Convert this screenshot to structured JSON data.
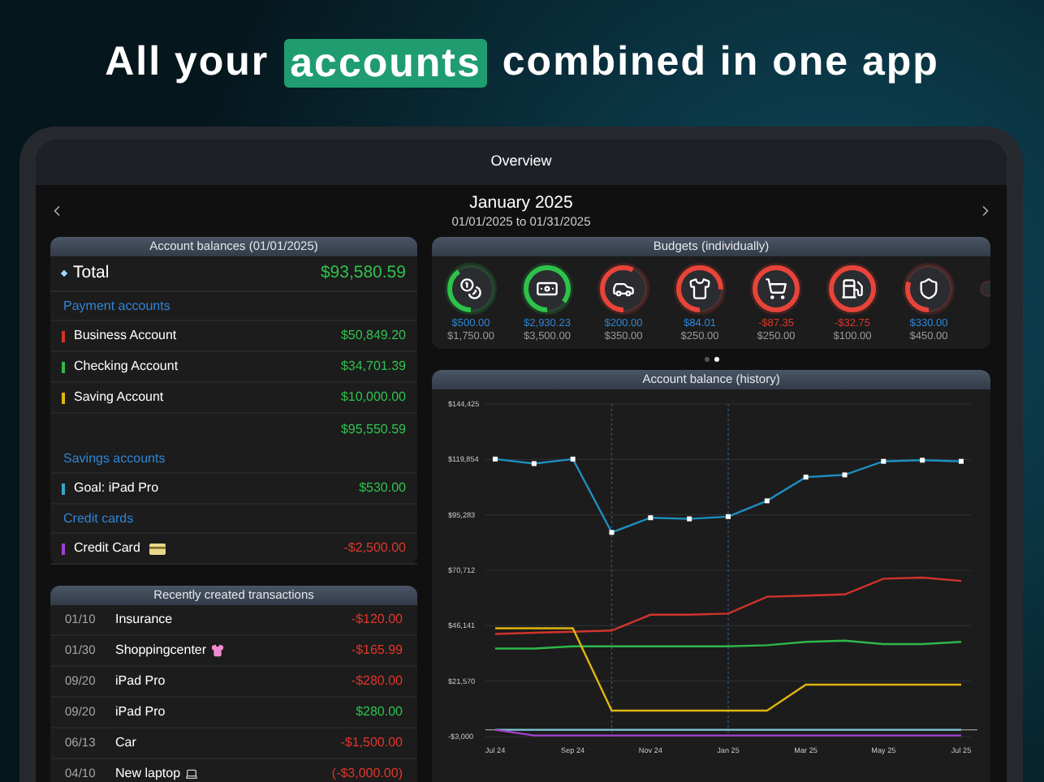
{
  "headline": {
    "before": "All your",
    "highlight": "accounts",
    "after": "combined in one app"
  },
  "window": {
    "title": "Overview"
  },
  "period": {
    "month": "January 2025",
    "range": "01/01/2025 to 01/31/2025"
  },
  "balances": {
    "title": "Account balances (01/01/2025)",
    "total": {
      "label": "Total",
      "amount": "$93,580.59"
    },
    "groups": [
      {
        "title": "Payment accounts",
        "accounts": [
          {
            "name": "Business Account",
            "amount": "$50,849.20",
            "color": "#d0342c",
            "negative": false
          },
          {
            "name": "Checking Account",
            "amount": "$34,701.39",
            "color": "#2eb84b",
            "negative": false
          },
          {
            "name": "Saving Account",
            "amount": "$10,000.00",
            "color": "#e0b50f",
            "negative": false
          }
        ],
        "subtotal": "$95,550.59"
      },
      {
        "title": "Savings accounts",
        "accounts": [
          {
            "name": "Goal: iPad Pro",
            "amount": "$530.00",
            "color": "#38a6c8",
            "negative": false
          }
        ]
      },
      {
        "title": "Credit cards",
        "accounts": [
          {
            "name": "Credit Card",
            "amount": "-$2,500.00",
            "color": "#a340d0",
            "negative": true
          }
        ]
      }
    ]
  },
  "transactions": {
    "title": "Recently created transactions",
    "rows": [
      {
        "date": "01/10",
        "name": "Insurance",
        "amount": "-$120.00",
        "kind": "expense"
      },
      {
        "date": "01/30",
        "name": "Shoppingcenter",
        "amount": "-$165.99",
        "kind": "expense"
      },
      {
        "date": "09/20",
        "name": "iPad Pro",
        "amount": "-$280.00",
        "kind": "expense"
      },
      {
        "date": "09/20",
        "name": "iPad Pro",
        "amount": "$280.00",
        "kind": "income"
      },
      {
        "date": "06/13",
        "name": "Car",
        "amount": "-$1,500.00",
        "kind": "expense"
      },
      {
        "date": "04/10",
        "name": "New laptop",
        "amount": "(-$3,000.00)",
        "kind": "expense"
      }
    ]
  },
  "budgets": {
    "title": "Budgets (individually)",
    "items": [
      {
        "level": 0.4,
        "color": "#2ec24a",
        "remaining": "$500.00",
        "over": false,
        "limit": "$1,750.00"
      },
      {
        "level": 0.85,
        "color": "#2ec24a",
        "remaining": "$2,930.23",
        "over": false,
        "limit": "$3,500.00"
      },
      {
        "level": 0.57,
        "color": "#e8443a",
        "remaining": "$200.00",
        "over": false,
        "limit": "$350.00"
      },
      {
        "level": 0.75,
        "color": "#e8443a",
        "remaining": "$84.01",
        "over": false,
        "limit": "$250.00"
      },
      {
        "level": 1,
        "color": "#e8443a",
        "remaining": "-$87.35",
        "over": true,
        "limit": "$250.00"
      },
      {
        "level": 1,
        "color": "#e8443a",
        "remaining": "-$32.75",
        "over": true,
        "limit": "$100.00"
      },
      {
        "level": 0.3,
        "color": "#e8443a",
        "remaining": "$330.00",
        "over": false,
        "limit": "$450.00"
      }
    ],
    "pages": [
      {
        "selected": false
      },
      {
        "selected": true
      }
    ]
  },
  "history": {
    "chart_data": {
      "type": "line",
      "title": "Account balance (history)",
      "categories": [
        "Jul 24",
        null,
        "Sep 24",
        null,
        "Nov 24",
        null,
        "Jan 25",
        null,
        "Mar 25",
        null,
        "May 25",
        null,
        "Jul 25"
      ],
      "ylim": [
        -3000,
        144425
      ],
      "grid": true,
      "yticks": [
        {
          "value": -3000,
          "label": "-$3,000"
        },
        {
          "value": 21570,
          "label": "$21,570"
        },
        {
          "value": 46141,
          "label": "$46,141"
        },
        {
          "value": 70712,
          "label": "$70,712"
        },
        {
          "value": 95283,
          "label": "$95,283"
        },
        {
          "value": 119854,
          "label": "$119,854"
        },
        {
          "value": 144425,
          "label": "$144,425"
        }
      ],
      "series": [
        {
          "color": "#1e8fc0",
          "marker": true,
          "values": [
            120000,
            118000,
            120000,
            87500,
            94000,
            93500,
            94500,
            101500,
            112000,
            113000,
            119000,
            119500,
            119000
          ]
        },
        {
          "color": "#d0342c",
          "marker": false,
          "values": [
            42500,
            43000,
            43500,
            44000,
            51000,
            51000,
            51500,
            59000,
            59500,
            60000,
            67000,
            67500,
            66000
          ]
        },
        {
          "color": "#2eb84b",
          "marker": false,
          "values": [
            36000,
            36000,
            37000,
            37000,
            37000,
            37000,
            37000,
            37500,
            39000,
            39500,
            38000,
            38000,
            39000
          ]
        },
        {
          "color": "#e0b50f",
          "marker": false,
          "values": [
            45000,
            45000,
            45000,
            8500,
            8500,
            8500,
            8500,
            8500,
            20000,
            20000,
            20000,
            20000,
            20000
          ]
        },
        {
          "color": "#7cc6d6",
          "marker": false,
          "values": [
            0,
            0,
            0,
            0,
            0,
            0,
            0,
            0,
            0,
            0,
            0,
            0,
            0
          ]
        },
        {
          "color": "#a340d0",
          "marker": false,
          "values": [
            0,
            -2500,
            -2500,
            -2500,
            -2500,
            -2500,
            -2500,
            -2500,
            -2500,
            -2500,
            -2500,
            -2500,
            -2500
          ]
        }
      ]
    }
  }
}
